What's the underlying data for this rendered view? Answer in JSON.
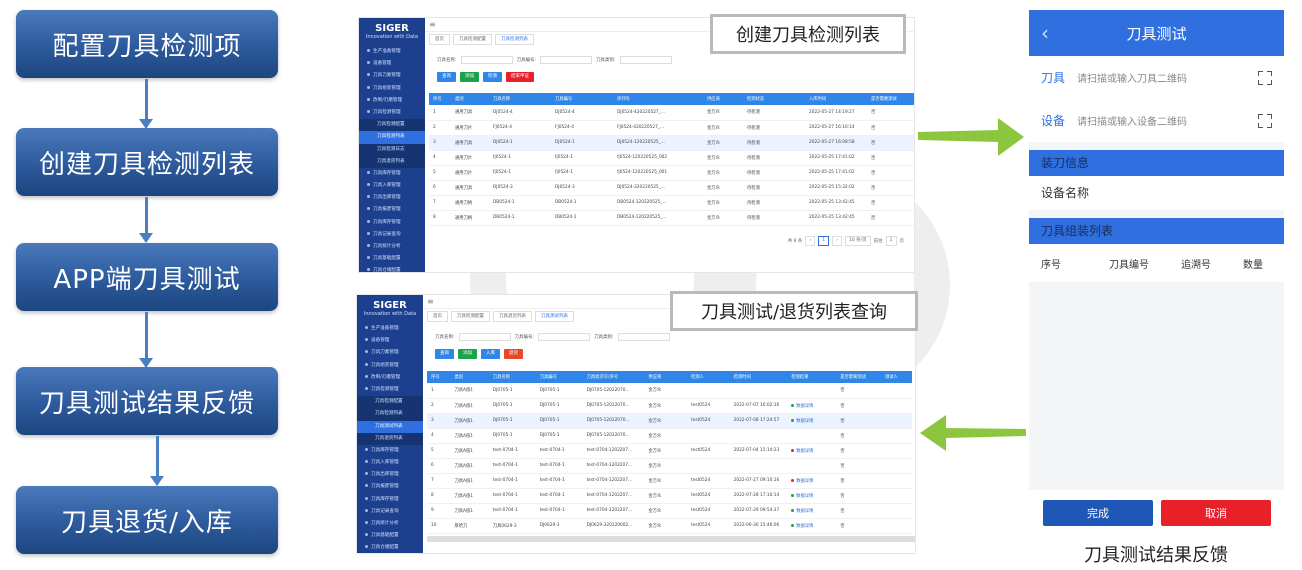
{
  "flow": {
    "steps": [
      "配置刀具检测项",
      "创建刀具检测列表",
      "APP端刀具测试",
      "刀具测试结果反馈",
      "刀具退货/入库"
    ]
  },
  "callouts": {
    "top": "创建刀具检测列表",
    "bottom": "刀具测试/退货列表查询"
  },
  "caption": "刀具测试结果反馈",
  "colors": {
    "flow_box": "#2c5a9c",
    "sidebar": "#1c3f8e",
    "table_header": "#2f86e8",
    "arrow": "#8cc63f",
    "mobile_header": "#2f6fe0",
    "ok_button": "#1f57b8",
    "cancel_button": "#e8202a"
  },
  "screen_top": {
    "brand": "SIGER",
    "brand_sub": "Innovation with Data",
    "menu": [
      "生产准备管理",
      "设备管理",
      "刀具刀素管理",
      "刀具组装管理",
      "改制/刃磨管理",
      "刀具检测管理",
      "刀具检测配置",
      "刀具检测列表",
      "刀具检测日志",
      "刀具退货列表",
      "刀具库存管理",
      "刀具入库管理",
      "刀具出库管理",
      "刀具报废管理",
      "刀具库存管理",
      "刀具记录查询",
      "刀具统计分析",
      "刀具基础配置",
      "刀具仓储配置"
    ],
    "tabs": [
      "首页",
      "刀具检测配置",
      "刀具检测列表"
    ],
    "filters": [
      "刀具名称:",
      "刀具编号:",
      "刀具类别:"
    ],
    "buttons": [
      "查询",
      "添加",
      "检测",
      "结束申证"
    ],
    "columns": [
      "序号",
      "类别",
      "刀具名称",
      "刀具编号",
      "序列号",
      "供应商",
      "检测状态",
      "入库时间",
      "是否需要测试"
    ],
    "rows": [
      [
        "1",
        "通用刀具",
        "DJ0524-4",
        "DJ0524-4",
        "DJ0524-420220527_...",
        "金万众",
        "待检测",
        "2022-05-27 14:19:27",
        "否"
      ],
      [
        "2",
        "通用刀片",
        "FJ0524-4",
        "FJ0524-4",
        "FJ0524-420220527_...",
        "金万众",
        "待检测",
        "2022-05-27 16:16:14",
        "否"
      ],
      [
        "3",
        "通用刀具",
        "DJ0524-1",
        "DJ0524-1",
        "DJ0524-120220525_...",
        "金万众",
        "待检测",
        "2022-05-27 16:08:58",
        "否"
      ],
      [
        "4",
        "通用刀片",
        "fj0524-1",
        "fj0524-1",
        "fj0524-120220525_002",
        "金万众",
        "待检测",
        "2022-05-25 17:41:02",
        "否"
      ],
      [
        "5",
        "通用刀片",
        "fj0524-1",
        "fj0524-1",
        "fj0524-120220525_001",
        "金万众",
        "待检测",
        "2022-05-25 17:41:02",
        "否"
      ],
      [
        "6",
        "通用刀具",
        "DJ0524-3",
        "DJ0524-3",
        "DJ0524-320220525_...",
        "金万众",
        "待检测",
        "2022-05-25 15:32:02",
        "否"
      ],
      [
        "7",
        "通用刀柄",
        "DB0524-1",
        "DB0524-1",
        "DB0524-120220525_...",
        "金万众",
        "待检测",
        "2022-05-25 13:42:45",
        "否"
      ],
      [
        "8",
        "通用刀柄",
        "DB0524-1",
        "DB0524-1",
        "DB0524-120220525_...",
        "金万众",
        "待检测",
        "2022-05-25 13:42:45",
        "否"
      ]
    ],
    "pager": {
      "total": "共 8 条",
      "page": "1",
      "per_page": "10 条/页",
      "goto": "前往",
      "goto_value": "1",
      "page_suffix": "页"
    }
  },
  "screen_bottom": {
    "brand": "SIGER",
    "brand_sub": "Innovation with Data",
    "menu": [
      "生产准备管理",
      "设备管理",
      "刀具刀素管理",
      "刀具组装管理",
      "改制/刃磨管理",
      "刀具检测管理",
      "刀具检测配置",
      "刀具检测列表",
      "刀具测试列表",
      "刀具退货列表",
      "刀具库存管理",
      "刀具入库管理",
      "刀具出库管理",
      "刀具报废管理",
      "刀具库存管理",
      "刀具记录查询",
      "刀具统计分析",
      "刀具基础配置",
      "刀具仓储配置"
    ],
    "tabs": [
      "首页",
      "刀具检测配置",
      "刀具退货列表",
      "刀具测试列表"
    ],
    "filters": [
      "刀具名称:",
      "刀具编号:",
      "刀具类别:"
    ],
    "buttons": [
      "查询",
      "添加",
      "入库",
      "退货"
    ],
    "columns": [
      "序号",
      "类别",
      "刀具名称",
      "刀具编号",
      "刀具批次号/序号",
      "供应商",
      "检测人",
      "检测时间",
      "检测结果",
      "是否需要测试",
      "测试人"
    ],
    "rows": [
      [
        "1",
        "刀具A值1",
        "DJ0705-1",
        "DJ0705-1",
        "DJ0705-12022070...",
        "金万众",
        "",
        "",
        "",
        "否",
        ""
      ],
      [
        "2",
        "刀具A值1",
        "DJ0705-1",
        "DJ0705-1",
        "DJ0705-12022070...",
        "金万众",
        "test0524",
        "2022-07-07 16:02:16",
        "数据详情",
        "否",
        ""
      ],
      [
        "3",
        "刀具A值1",
        "DJ0705-1",
        "DJ0705-1",
        "DJ0705-12022070...",
        "金万众",
        "test0524",
        "2022-07-08 17:24:57",
        "数据详情",
        "否",
        ""
      ],
      [
        "4",
        "刀具A值1",
        "DJ0705-1",
        "DJ0705-1",
        "DJ0705-12022070...",
        "金万众",
        "",
        "",
        "",
        "否",
        ""
      ],
      [
        "5",
        "刀具A值1",
        "test-0704-1",
        "test-0704-1",
        "test-0704-1202207...",
        "金万众",
        "test0524",
        "2022-07-04 15:14:23",
        "数据详情",
        "否",
        ""
      ],
      [
        "6",
        "刀具A值1",
        "test-0704-1",
        "test-0704-1",
        "test-0704-1202207...",
        "金万众",
        "",
        "",
        "",
        "否",
        ""
      ],
      [
        "7",
        "刀具A值1",
        "test-0704-1",
        "test-0704-1",
        "test-0704-1202207...",
        "金万众",
        "test0524",
        "2022-07-27 09:10:16",
        "数据详情",
        "否",
        ""
      ],
      [
        "8",
        "刀具A值1",
        "test-0704-1",
        "test-0704-1",
        "test-0704-1202207...",
        "金万众",
        "test0524",
        "2022-07-28 17:10:14",
        "数据详情",
        "否",
        ""
      ],
      [
        "9",
        "刀具A值1",
        "test-0704-1",
        "test-0704-1",
        "test-0704-1202207...",
        "金万众",
        "test0524",
        "2022-07-29 09:54:37",
        "数据详情",
        "否",
        ""
      ],
      [
        "10",
        "厚哈刀",
        "刀具0629-3",
        "DJ0629-3",
        "DJ0629-320220602...",
        "金万众",
        "test0524",
        "2022-06-30 15:46:06",
        "数据详情",
        "否",
        ""
      ]
    ]
  },
  "mobile": {
    "title": "刀具测试",
    "fields": [
      {
        "label": "刀具",
        "placeholder": "请扫描或输入刀具二维码"
      },
      {
        "label": "设备",
        "placeholder": "请扫描或输入设备二维码"
      }
    ],
    "section1": "装刀信息",
    "device_name": "设备名称",
    "section2": "刀具组装列表",
    "columns": [
      "序号",
      "刀具编号",
      "追溯号",
      "数量"
    ],
    "ok": "完成",
    "cancel": "取消"
  }
}
